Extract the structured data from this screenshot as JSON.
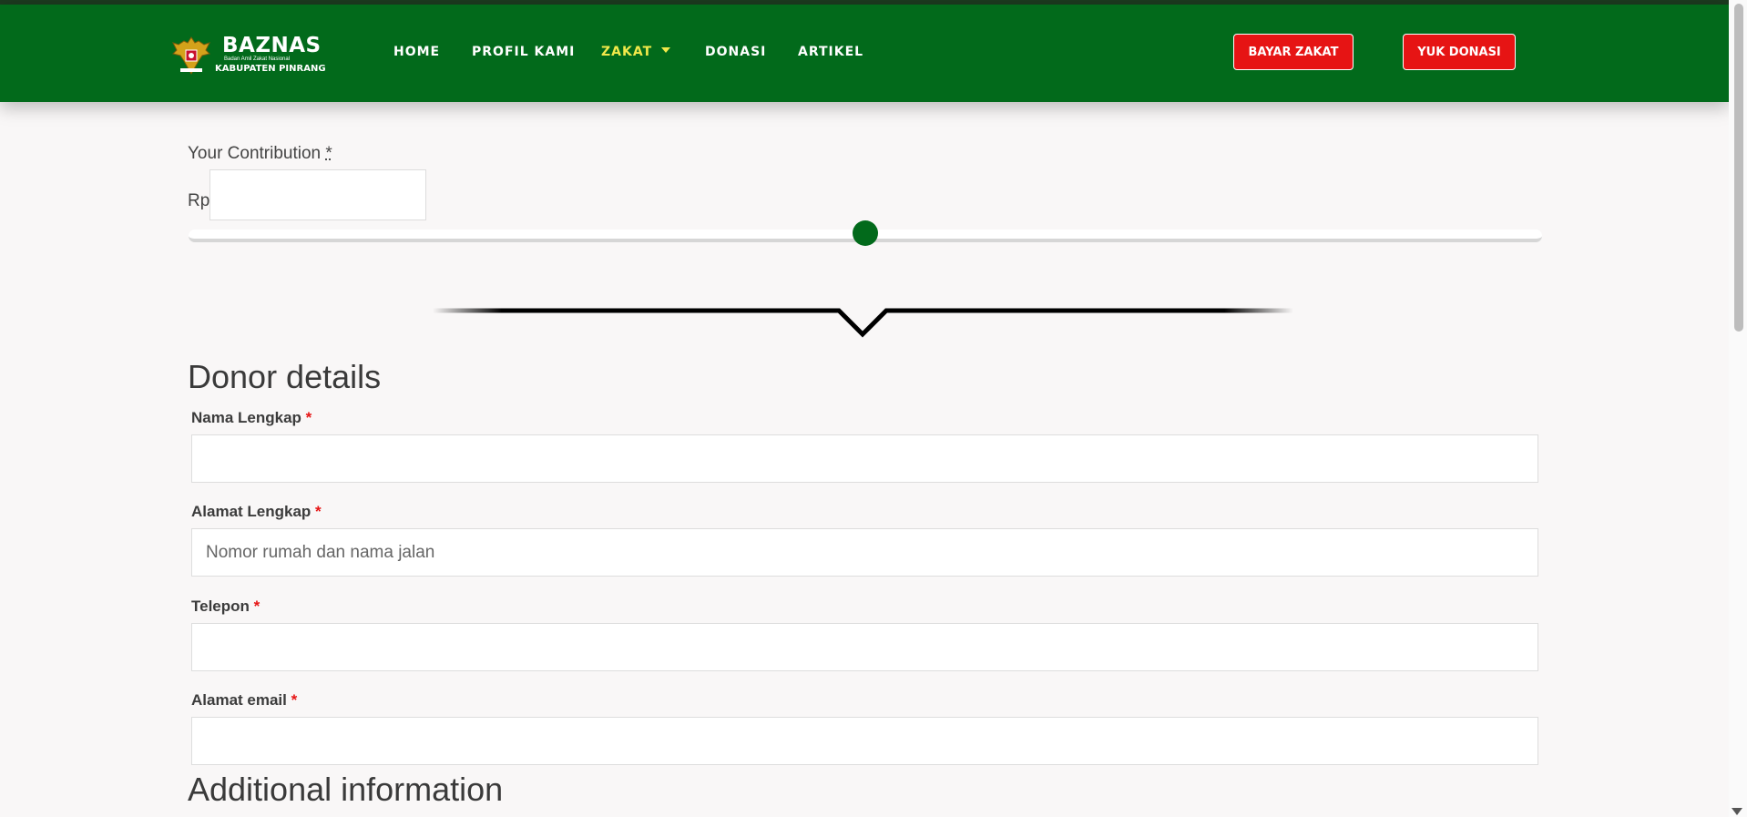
{
  "header": {
    "logo": {
      "title": "BAZNAS",
      "subtitle": "Badan Amil Zakat Nasional",
      "region": "KABUPATEN PINRANG"
    },
    "nav": [
      {
        "label": "HOME"
      },
      {
        "label": "PROFIL KAMI"
      },
      {
        "label": "ZAKAT",
        "active": true
      },
      {
        "label": "DONASI"
      },
      {
        "label": "ARTIKEL"
      }
    ],
    "buttons": {
      "bayar_zakat": "BAYAR ZAKAT",
      "yuk_donasi": "YUK DONASI"
    },
    "colors": {
      "header_bg": "#026a1b",
      "active_nav": "#f2e94a",
      "button_bg": "#e61414"
    }
  },
  "contribution": {
    "label": "Your Contribution",
    "required_mark": "*",
    "currency": "Rp",
    "amount_value": "",
    "slider_level": 0.5
  },
  "donor": {
    "title": "Donor details",
    "fields": [
      {
        "label": "Nama Lengkap",
        "required": "*",
        "value": "",
        "placeholder": ""
      },
      {
        "label": "Alamat Lengkap",
        "required": "*",
        "value": "",
        "placeholder": "Nomor rumah dan nama jalan"
      },
      {
        "label": "Telepon",
        "required": "*",
        "value": "",
        "placeholder": ""
      },
      {
        "label": "Alamat email",
        "required": "*",
        "value": "",
        "placeholder": ""
      }
    ]
  },
  "additional": {
    "title": "Additional information"
  }
}
